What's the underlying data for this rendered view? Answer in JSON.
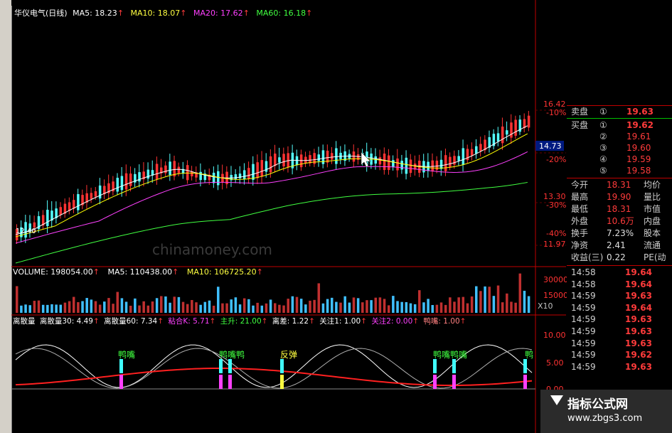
{
  "main_header": {
    "title": "华仪电气(日线)",
    "ma5": "MA5: 18.23",
    "ma10": "MA10: 18.07",
    "ma20": "MA20: 17.62",
    "ma60": "MA60: 16.18",
    "arrow": "↑"
  },
  "price_axis": {
    "labels": [
      "16.42",
      "-10%",
      "-20%",
      "13.30",
      "-30%",
      "-40%",
      "11.97"
    ],
    "current": "14.73",
    "low_label": "12.40"
  },
  "volume_header": {
    "volume": "VOLUME: 198054.00",
    "ma5": "MA5: 110438.00",
    "ma10": "MA10: 106725.20",
    "axis": [
      "30000",
      "15000",
      "X10"
    ]
  },
  "indicator_header": {
    "items": [
      "离散量",
      "离散量30: 4.49",
      "离散量60: 7.34",
      "粘合K: 5.71",
      "主升: 21.00",
      "离差: 1.22",
      "关注1: 1.00",
      "关注2: 0.00",
      "鸭嘴: 1.00"
    ],
    "axis": [
      "10.00",
      "5.00",
      "0.00"
    ]
  },
  "annotations": [
    "鸭嘴",
    "鸭嘴鸭",
    "反弹",
    "鸭嘴鸭嘴",
    "鸭"
  ],
  "watermark": "chinamoney.com",
  "quote_panel": {
    "sell": {
      "label": "卖盘",
      "num": "①",
      "price": "19.63"
    },
    "buy": [
      {
        "label": "买盘",
        "num": "①",
        "price": "19.62"
      },
      {
        "label": "",
        "num": "②",
        "price": "19.61"
      },
      {
        "label": "",
        "num": "③",
        "price": "19.60"
      },
      {
        "label": "",
        "num": "④",
        "price": "19.59"
      },
      {
        "label": "",
        "num": "⑤",
        "price": "19.58"
      }
    ],
    "stats": [
      {
        "label": "今开",
        "value": "18.31",
        "right": "均价"
      },
      {
        "label": "最高",
        "value": "19.90",
        "right": "量比"
      },
      {
        "label": "最低",
        "value": "18.31",
        "right": "市值"
      },
      {
        "label": "外盘",
        "value": "10.6万",
        "right": "内盘"
      },
      {
        "label": "换手",
        "value": "7.23%",
        "right": "股本"
      },
      {
        "label": "净资",
        "value": "2.41",
        "right": "流通"
      },
      {
        "label": "收益(三)",
        "value": "0.22",
        "right": "PE(动"
      }
    ],
    "ticks": [
      {
        "time": "14:58",
        "price": "19.64"
      },
      {
        "time": "14:58",
        "price": "19.64"
      },
      {
        "time": "14:59",
        "price": "19.63"
      },
      {
        "time": "14:59",
        "price": "19.64"
      },
      {
        "time": "14:59",
        "price": "19.63"
      },
      {
        "time": "14:59",
        "price": "19.63"
      },
      {
        "time": "14:59",
        "price": "19.63"
      },
      {
        "time": "14:59",
        "price": "19.62"
      },
      {
        "time": "14:59",
        "price": "19.63"
      }
    ]
  },
  "site_logo": {
    "line1": "指标公式网",
    "line2": "www.zbgs3.com"
  },
  "colors": {
    "up": "#ff3333",
    "down": "#54ffff",
    "ma5": "#ffffff",
    "ma10": "#ffff00",
    "ma20": "#ff40ff",
    "ma60": "#40ff40"
  }
}
